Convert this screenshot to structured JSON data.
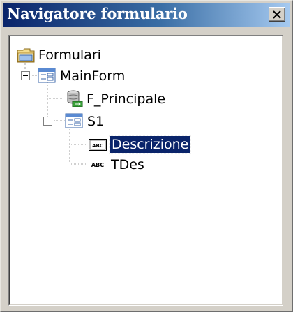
{
  "window": {
    "title": "Navigatore formulario",
    "close_label": "×"
  },
  "tree": {
    "root": {
      "label": "Formulari",
      "icon": "folder-icon"
    },
    "mainform": {
      "label": "MainForm",
      "icon": "form-icon",
      "expanded": true
    },
    "f_principale": {
      "label": "F_Principale",
      "icon": "database-icon"
    },
    "s1": {
      "label": "S1",
      "icon": "form-icon",
      "expanded": true
    },
    "descrizione": {
      "label": "Descrizione",
      "icon": "text-field-icon",
      "selected": true
    },
    "tdes": {
      "label": "TDes",
      "icon": "label-icon"
    }
  },
  "colors": {
    "title_start": "#0a246a",
    "title_end": "#a6caf0",
    "selection": "#0a246a"
  }
}
